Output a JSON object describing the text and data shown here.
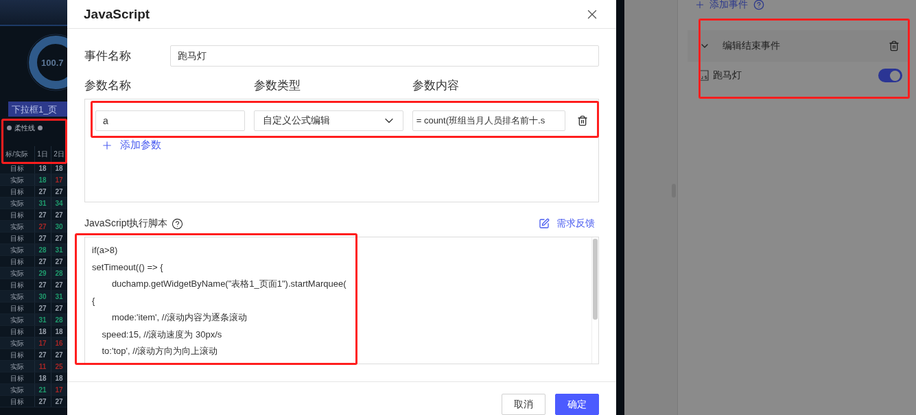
{
  "dashboard": {
    "gauge_value": "100.7",
    "dropdown_label": "下拉框1_页",
    "widget_label": "柔性线",
    "table": {
      "columns": [
        "标/实际",
        "1日",
        "2日"
      ],
      "rows": [
        {
          "cells": [
            {
              "text": "目标"
            },
            {
              "text": "18"
            },
            {
              "text": "18"
            }
          ]
        },
        {
          "cells": [
            {
              "text": "实际"
            },
            {
              "text": "18",
              "color": "#1f9a6c"
            },
            {
              "text": "17",
              "color": "#a52626"
            }
          ]
        },
        {
          "cells": [
            {
              "text": "目标"
            },
            {
              "text": "27"
            },
            {
              "text": "27"
            }
          ]
        },
        {
          "cells": [
            {
              "text": "实际"
            },
            {
              "text": "31",
              "color": "#1f9a6c"
            },
            {
              "text": "34",
              "color": "#1f9a6c"
            }
          ]
        },
        {
          "cells": [
            {
              "text": "目标"
            },
            {
              "text": "27"
            },
            {
              "text": "27"
            }
          ]
        },
        {
          "cells": [
            {
              "text": "实际"
            },
            {
              "text": "27",
              "color": "#a52626"
            },
            {
              "text": "30",
              "color": "#1f9a6c"
            }
          ]
        },
        {
          "cells": [
            {
              "text": "目标"
            },
            {
              "text": "27"
            },
            {
              "text": "27"
            }
          ]
        },
        {
          "cells": [
            {
              "text": "实际"
            },
            {
              "text": "28",
              "color": "#1f9a6c"
            },
            {
              "text": "31",
              "color": "#1f9a6c"
            }
          ]
        },
        {
          "cells": [
            {
              "text": "目标"
            },
            {
              "text": "27"
            },
            {
              "text": "27"
            }
          ]
        },
        {
          "cells": [
            {
              "text": "实际"
            },
            {
              "text": "29",
              "color": "#1f9a6c"
            },
            {
              "text": "28",
              "color": "#1f9a6c"
            }
          ]
        },
        {
          "cells": [
            {
              "text": "目标"
            },
            {
              "text": "27"
            },
            {
              "text": "27"
            }
          ]
        },
        {
          "cells": [
            {
              "text": "实际"
            },
            {
              "text": "30",
              "color": "#1f9a6c"
            },
            {
              "text": "31",
              "color": "#1f9a6c"
            }
          ]
        },
        {
          "cells": [
            {
              "text": "目标"
            },
            {
              "text": "27"
            },
            {
              "text": "27"
            }
          ]
        },
        {
          "cells": [
            {
              "text": "实际"
            },
            {
              "text": "31",
              "color": "#1f9a6c"
            },
            {
              "text": "28",
              "color": "#1f9a6c"
            }
          ]
        },
        {
          "cells": [
            {
              "text": "目标"
            },
            {
              "text": "18"
            },
            {
              "text": "18"
            }
          ]
        },
        {
          "cells": [
            {
              "text": "实际"
            },
            {
              "text": "17",
              "color": "#a52626"
            },
            {
              "text": "16",
              "color": "#a52626"
            }
          ]
        },
        {
          "cells": [
            {
              "text": "目标"
            },
            {
              "text": "27"
            },
            {
              "text": "27"
            }
          ]
        },
        {
          "cells": [
            {
              "text": "实际"
            },
            {
              "text": "11",
              "color": "#a52626"
            },
            {
              "text": "25",
              "color": "#a52626"
            }
          ]
        },
        {
          "cells": [
            {
              "text": "目标"
            },
            {
              "text": "18"
            },
            {
              "text": "18"
            }
          ]
        },
        {
          "cells": [
            {
              "text": "实际"
            },
            {
              "text": "21",
              "color": "#1f9a6c"
            },
            {
              "text": "17",
              "color": "#a52626"
            }
          ]
        },
        {
          "cells": [
            {
              "text": "目标"
            },
            {
              "text": "27"
            },
            {
              "text": "27"
            }
          ]
        }
      ]
    }
  },
  "dialog": {
    "title": "JavaScript",
    "event_name_label": "事件名称",
    "event_name": "跑马灯",
    "param_headers": [
      "参数名称",
      "参数类型",
      "参数内容"
    ],
    "params": [
      {
        "name": "a",
        "type": "自定义公式编辑",
        "content": "= count(班组当月人员排名前十.s"
      }
    ],
    "add_param": "添加参数",
    "script_label": "JavaScript执行脚本",
    "feedback": "需求反馈",
    "script_lines": [
      "if(a>8)",
      "setTimeout(() => {",
      "        duchamp.getWidgetByName(\"表格1_页面1\").startMarquee(",
      "{",
      "        mode:'item', //滚动内容为逐条滚动",
      "    speed:15, //滚动速度为 30px/s",
      "    to:'top', //滚动方向为向上滚动"
    ],
    "buttons": [
      {
        "label": "取消",
        "kind": "secondary"
      },
      {
        "label": "确定",
        "kind": "primary"
      }
    ]
  },
  "event_panel": {
    "add_event": "添加事件",
    "groups": [
      {
        "title": "编辑结束事件",
        "expanded": true,
        "items": [
          {
            "name": "跑马灯",
            "on": true
          }
        ]
      }
    ]
  }
}
